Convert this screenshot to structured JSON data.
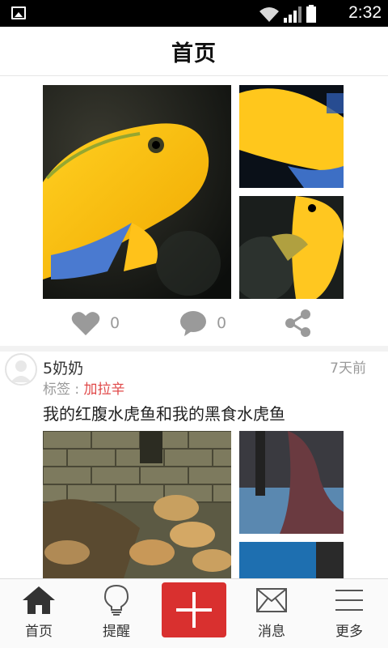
{
  "status_bar": {
    "time": "2:32"
  },
  "header": {
    "title": "首页"
  },
  "posts": [
    {
      "actions": {
        "likes": "0",
        "comments": "0"
      }
    },
    {
      "author": "5奶奶",
      "time_ago": "7天前",
      "tag_label": "标签 :",
      "tag": "加拉辛",
      "title": "我的红腹水虎鱼和我的黑食水虎鱼"
    }
  ],
  "bottom_nav": [
    {
      "label": "首页",
      "icon": "home-icon"
    },
    {
      "label": "提醒",
      "icon": "lightbulb-icon"
    },
    {
      "label": "",
      "icon": "plus-icon"
    },
    {
      "label": "消息",
      "icon": "mail-icon"
    },
    {
      "label": "更多",
      "icon": "menu-icon"
    }
  ],
  "colors": {
    "accent": "#d9302f",
    "tag": "#e04848",
    "icon_gray": "#999999"
  }
}
